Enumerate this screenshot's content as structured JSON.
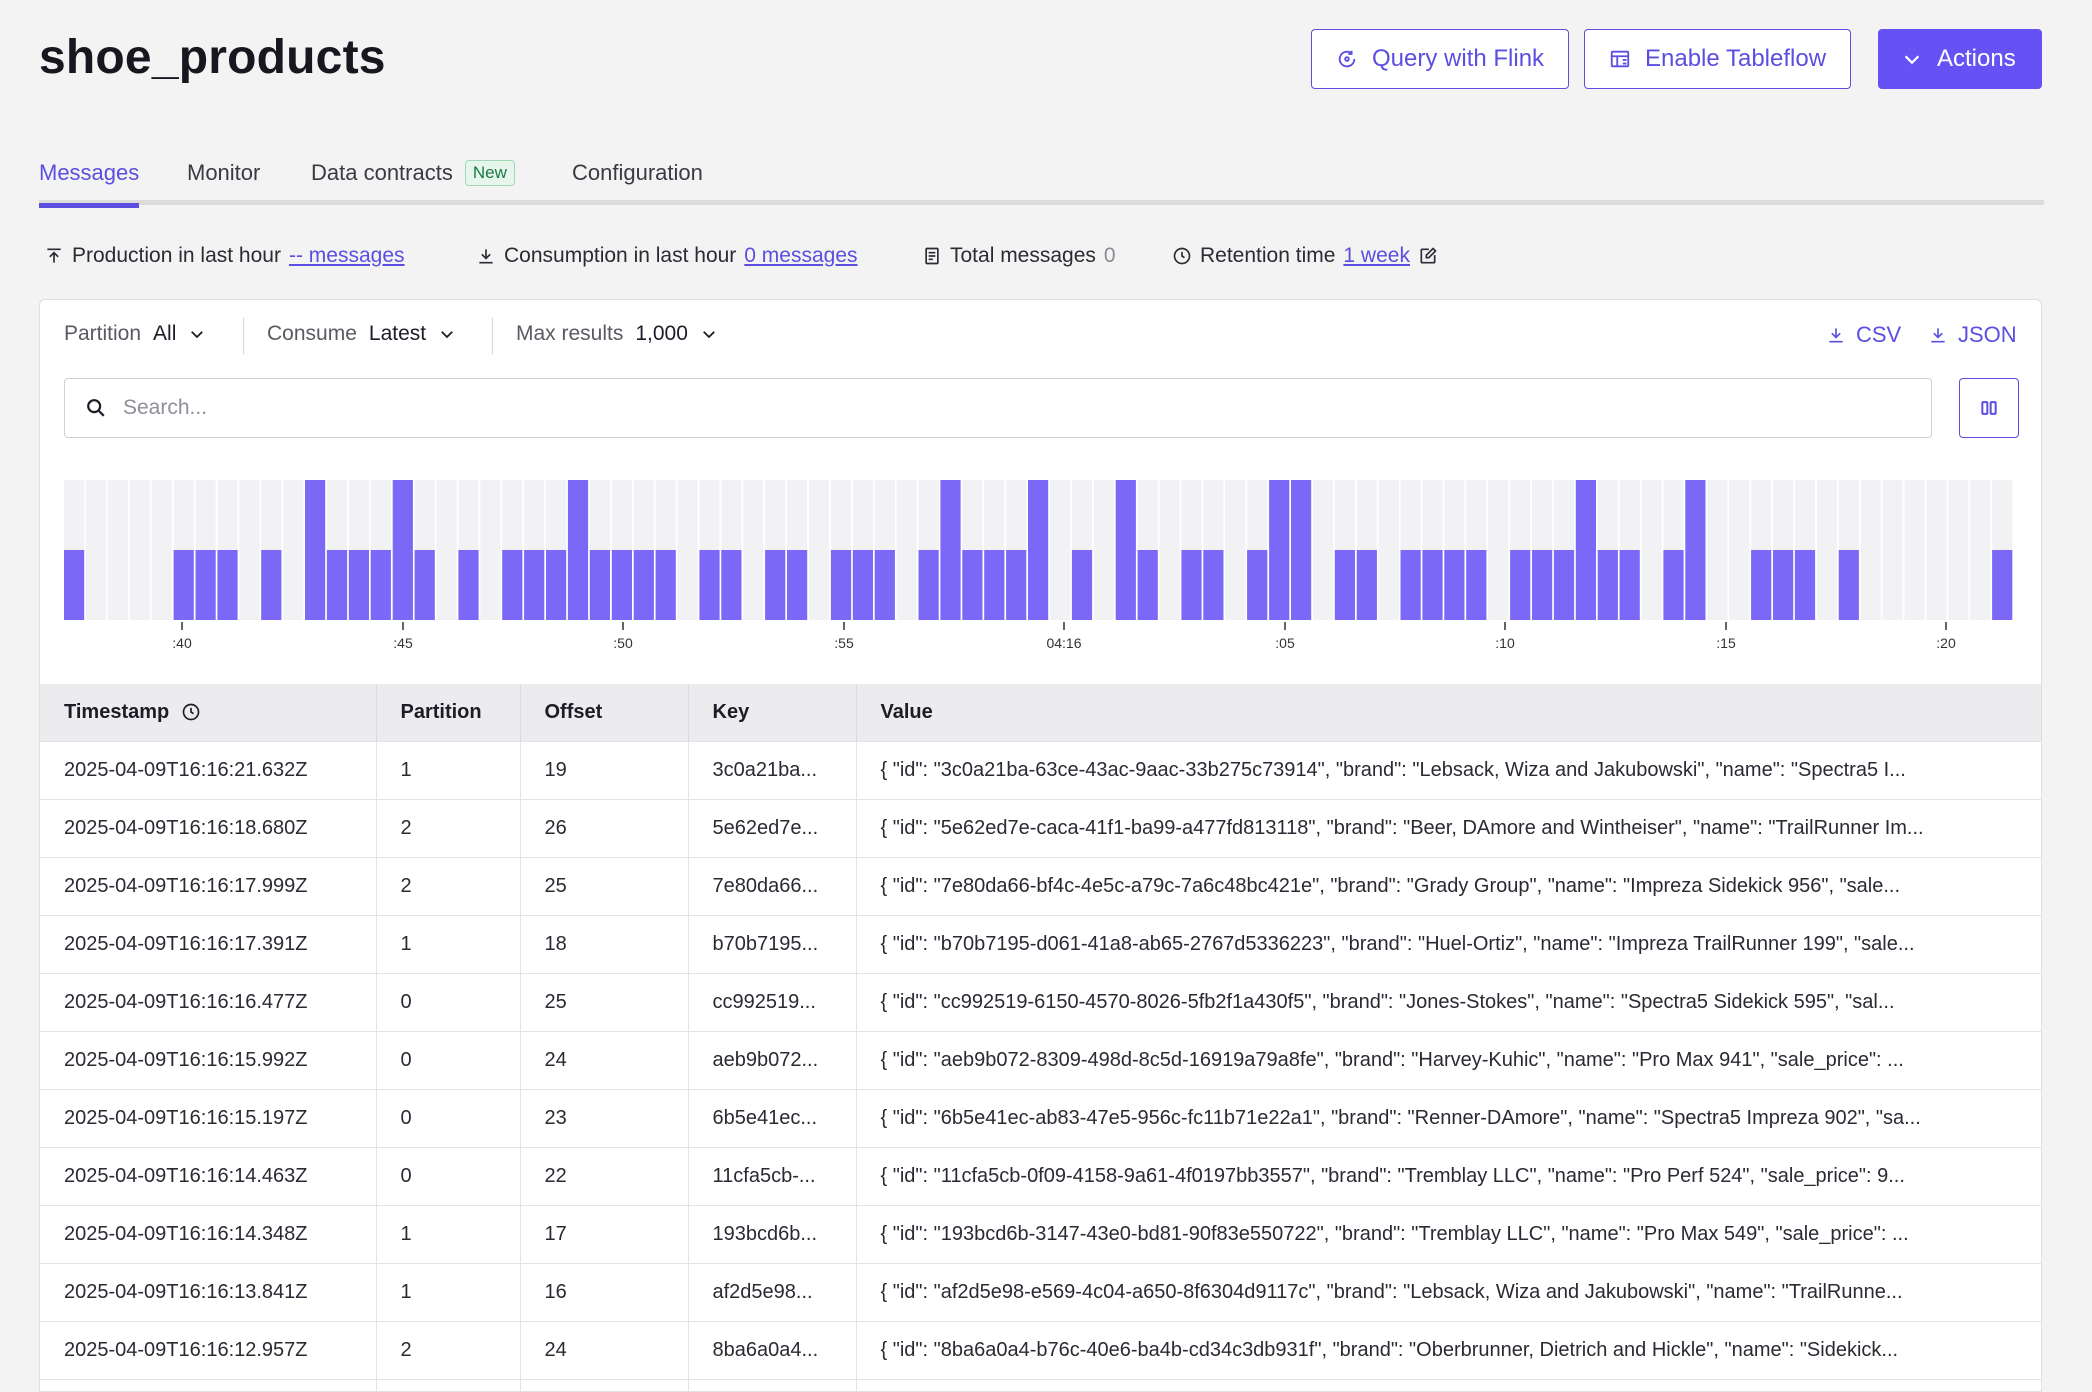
{
  "page": {
    "title": "shoe_products"
  },
  "header_buttons": {
    "flink": "Query with Flink",
    "tableflow": "Enable Tableflow",
    "actions": "Actions"
  },
  "tabs": [
    {
      "label": "Messages",
      "active": true
    },
    {
      "label": "Monitor"
    },
    {
      "label": "Data contracts",
      "badge": "New"
    },
    {
      "label": "Configuration"
    }
  ],
  "stats": {
    "production_label": "Production in last hour",
    "production_value": "-- messages",
    "consumption_label": "Consumption in last hour",
    "consumption_value": "0 messages",
    "total_label": "Total messages",
    "total_value": "0",
    "retention_label": "Retention time",
    "retention_value": "1 week"
  },
  "controls": {
    "partition_label": "Partition",
    "partition_value": "All",
    "consume_label": "Consume",
    "consume_value": "Latest",
    "max_label": "Max results",
    "max_value": "1,000",
    "csv": "CSV",
    "json": "JSON"
  },
  "search": {
    "placeholder": "Search..."
  },
  "chart_data": {
    "type": "bar",
    "accent": "#7b68f7",
    "tick_labels": [
      ":40",
      ":45",
      ":50",
      ":55",
      "04:16",
      ":05",
      ":10",
      ":15",
      ":20"
    ],
    "values": [
      1,
      0,
      0,
      0,
      0,
      1,
      1,
      1,
      0,
      1,
      0,
      2,
      1,
      1,
      1,
      2,
      1,
      0,
      1,
      0,
      1,
      1,
      1,
      2,
      1,
      1,
      1,
      1,
      0,
      1,
      1,
      0,
      1,
      1,
      0,
      1,
      1,
      1,
      0,
      1,
      2,
      1,
      1,
      1,
      2,
      0,
      1,
      0,
      2,
      1,
      0,
      1,
      1,
      0,
      1,
      2,
      2,
      0,
      1,
      1,
      0,
      1,
      1,
      1,
      1,
      0,
      1,
      1,
      1,
      2,
      1,
      1,
      0,
      1,
      2,
      0,
      0,
      1,
      1,
      1,
      0,
      1,
      0,
      0,
      0,
      0,
      0,
      0,
      1
    ]
  },
  "table": {
    "headers": [
      "Timestamp",
      "Partition",
      "Offset",
      "Key",
      "Value"
    ],
    "rows": [
      [
        "2025-04-09T16:16:21.632Z",
        "1",
        "19",
        "3c0a21ba...",
        "{ \"id\": \"3c0a21ba-63ce-43ac-9aac-33b275c73914\", \"brand\": \"Lebsack, Wiza and Jakubowski\", \"name\": \"Spectra5 I..."
      ],
      [
        "2025-04-09T16:16:18.680Z",
        "2",
        "26",
        "5e62ed7e...",
        "{ \"id\": \"5e62ed7e-caca-41f1-ba99-a477fd813118\", \"brand\": \"Beer, DAmore and Wintheiser\", \"name\": \"TrailRunner Im..."
      ],
      [
        "2025-04-09T16:16:17.999Z",
        "2",
        "25",
        "7e80da66...",
        "{ \"id\": \"7e80da66-bf4c-4e5c-a79c-7a6c48bc421e\", \"brand\": \"Grady Group\", \"name\": \"Impreza Sidekick 956\", \"sale..."
      ],
      [
        "2025-04-09T16:16:17.391Z",
        "1",
        "18",
        "b70b7195...",
        "{ \"id\": \"b70b7195-d061-41a8-ab65-2767d5336223\", \"brand\": \"Huel-Ortiz\", \"name\": \"Impreza TrailRunner 199\", \"sale..."
      ],
      [
        "2025-04-09T16:16:16.477Z",
        "0",
        "25",
        "cc992519...",
        "{ \"id\": \"cc992519-6150-4570-8026-5fb2f1a430f5\", \"brand\": \"Jones-Stokes\", \"name\": \"Spectra5 Sidekick 595\", \"sal..."
      ],
      [
        "2025-04-09T16:16:15.992Z",
        "0",
        "24",
        "aeb9b072...",
        "{ \"id\": \"aeb9b072-8309-498d-8c5d-16919a79a8fe\", \"brand\": \"Harvey-Kuhic\", \"name\": \"Pro Max 941\", \"sale_price\": ..."
      ],
      [
        "2025-04-09T16:16:15.197Z",
        "0",
        "23",
        "6b5e41ec...",
        "{ \"id\": \"6b5e41ec-ab83-47e5-956c-fc11b71e22a1\", \"brand\": \"Renner-DAmore\", \"name\": \"Spectra5 Impreza 902\", \"sa..."
      ],
      [
        "2025-04-09T16:16:14.463Z",
        "0",
        "22",
        "11cfa5cb-...",
        "{ \"id\": \"11cfa5cb-0f09-4158-9a61-4f0197bb3557\", \"brand\": \"Tremblay LLC\", \"name\": \"Pro Perf 524\", \"sale_price\": 9..."
      ],
      [
        "2025-04-09T16:16:14.348Z",
        "1",
        "17",
        "193bcd6b...",
        "{ \"id\": \"193bcd6b-3147-43e0-bd81-90f83e550722\", \"brand\": \"Tremblay LLC\", \"name\": \"Pro Max 549\", \"sale_price\": ..."
      ],
      [
        "2025-04-09T16:16:13.841Z",
        "1",
        "16",
        "af2d5e98...",
        "{ \"id\": \"af2d5e98-e569-4c04-a650-8f6304d9117c\", \"brand\": \"Lebsack, Wiza and Jakubowski\", \"name\": \"TrailRunne..."
      ],
      [
        "2025-04-09T16:16:12.957Z",
        "2",
        "24",
        "8ba6a0a4...",
        "{ \"id\": \"8ba6a0a4-b76c-40e6-ba4b-cd34c3db931f\", \"brand\": \"Oberbrunner, Dietrich and Hickle\", \"name\": \"Sidekick..."
      ],
      [
        "",
        "",
        "",
        "",
        ""
      ]
    ]
  }
}
